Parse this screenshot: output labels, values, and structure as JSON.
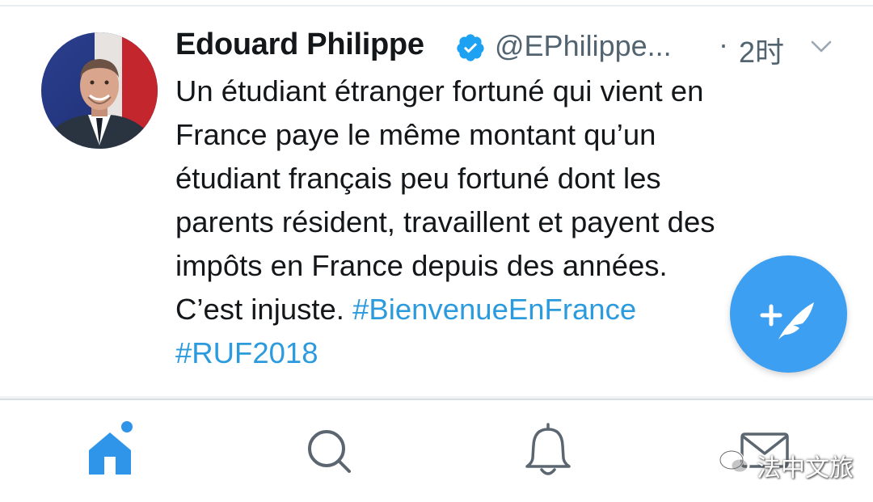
{
  "tweet": {
    "display_name": "Edouard Philippe",
    "handle": "@EPhilippe...",
    "separator": "·",
    "time": "2时",
    "lines": [
      [
        {
          "text": "Un étudiant étranger fortuné qui vient en",
          "link": false
        }
      ],
      [
        {
          "text": "France paye le même montant qu’un",
          "link": false
        }
      ],
      [
        {
          "text": "étudiant français peu fortuné dont les",
          "link": false
        }
      ],
      [
        {
          "text": "parents résident, travaillent et payent des",
          "link": false
        }
      ],
      [
        {
          "text": "impôts en France depuis des années.",
          "link": false
        }
      ],
      [
        {
          "text": "C’est injuste. ",
          "link": false
        },
        {
          "text": "#BienvenueEnFrance",
          "link": true
        }
      ],
      [
        {
          "text": "#RUF2018",
          "link": true
        }
      ]
    ]
  },
  "icons": {
    "verified": "verified-badge-icon",
    "options": "chevron-down-icon",
    "compose": "compose-tweet-icon",
    "home": "home-icon",
    "search": "search-icon",
    "notifications": "bell-icon",
    "messages": "mail-icon"
  },
  "tabs": [
    {
      "name": "home",
      "active": true
    },
    {
      "name": "search",
      "active": false
    },
    {
      "name": "notifications",
      "active": false
    },
    {
      "name": "messages",
      "active": false
    }
  ],
  "watermark": {
    "text": "法中文旅"
  },
  "colors": {
    "accent": "#1da1f2",
    "fab": "#3d9ff2",
    "hashtag": "#2b9bde",
    "secondary_text": "#536471",
    "tab_icon": "#5b6670"
  }
}
